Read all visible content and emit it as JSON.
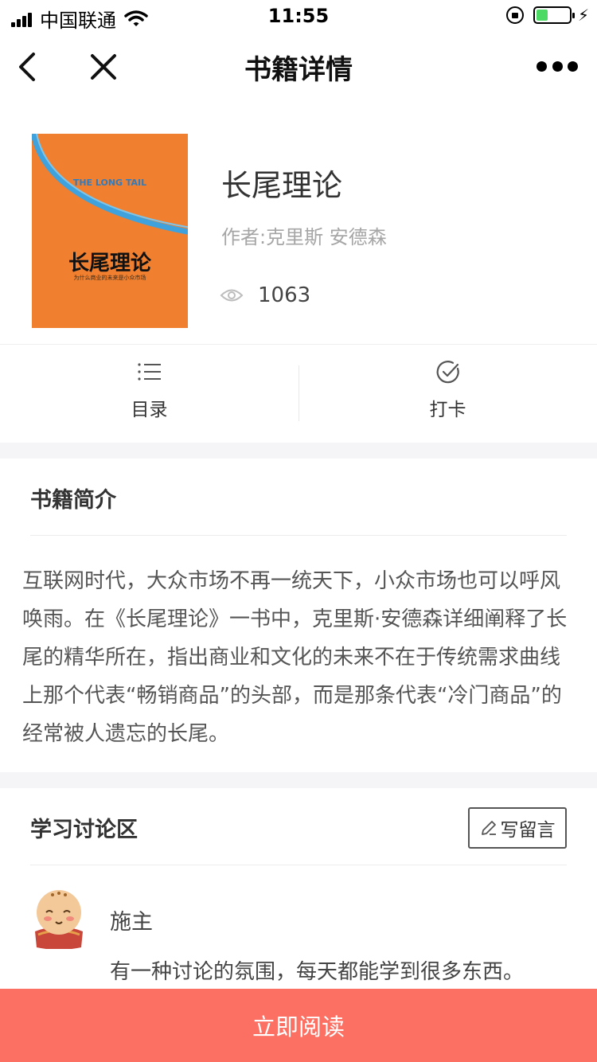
{
  "status_bar": {
    "carrier": "中国联通",
    "time": "11:55",
    "battery_level": 0.35
  },
  "nav": {
    "title": "书籍详情",
    "icons": [
      "back-icon",
      "close-icon",
      "more-icon"
    ]
  },
  "book": {
    "title": "长尾理论",
    "author": "作者:克里斯 安德森",
    "views": "1063",
    "cover": {
      "en_title": "THE LONG TAIL",
      "cn_title": "长尾理论",
      "subtitle": "为什么商业的未来是小众市场",
      "color": "#f0802f"
    }
  },
  "tabs": [
    {
      "label": "目录",
      "icon": "list-icon"
    },
    {
      "label": "打卡",
      "icon": "check-circle-icon"
    }
  ],
  "intro": {
    "heading": "书籍简介",
    "text": "互联网时代，大众市场不再一统天下，小众市场也可以呼风唤雨。在《长尾理论》一书中，克里斯·安德森详细阐释了长尾的精华所在，指出商业和文化的未来不在于传统需求曲线上那个代表“畅销商品”的头部，而是那条代表“冷门商品”的经常被人遗忘的长尾。"
  },
  "discussion": {
    "heading": "学习讨论区",
    "write_button": "写留言",
    "comments": [
      {
        "name": "施主",
        "text": "有一种讨论的氛围，每天都能学到很多东西。"
      }
    ]
  },
  "footer": {
    "read_button": "立即阅读",
    "color": "#fb7062"
  }
}
